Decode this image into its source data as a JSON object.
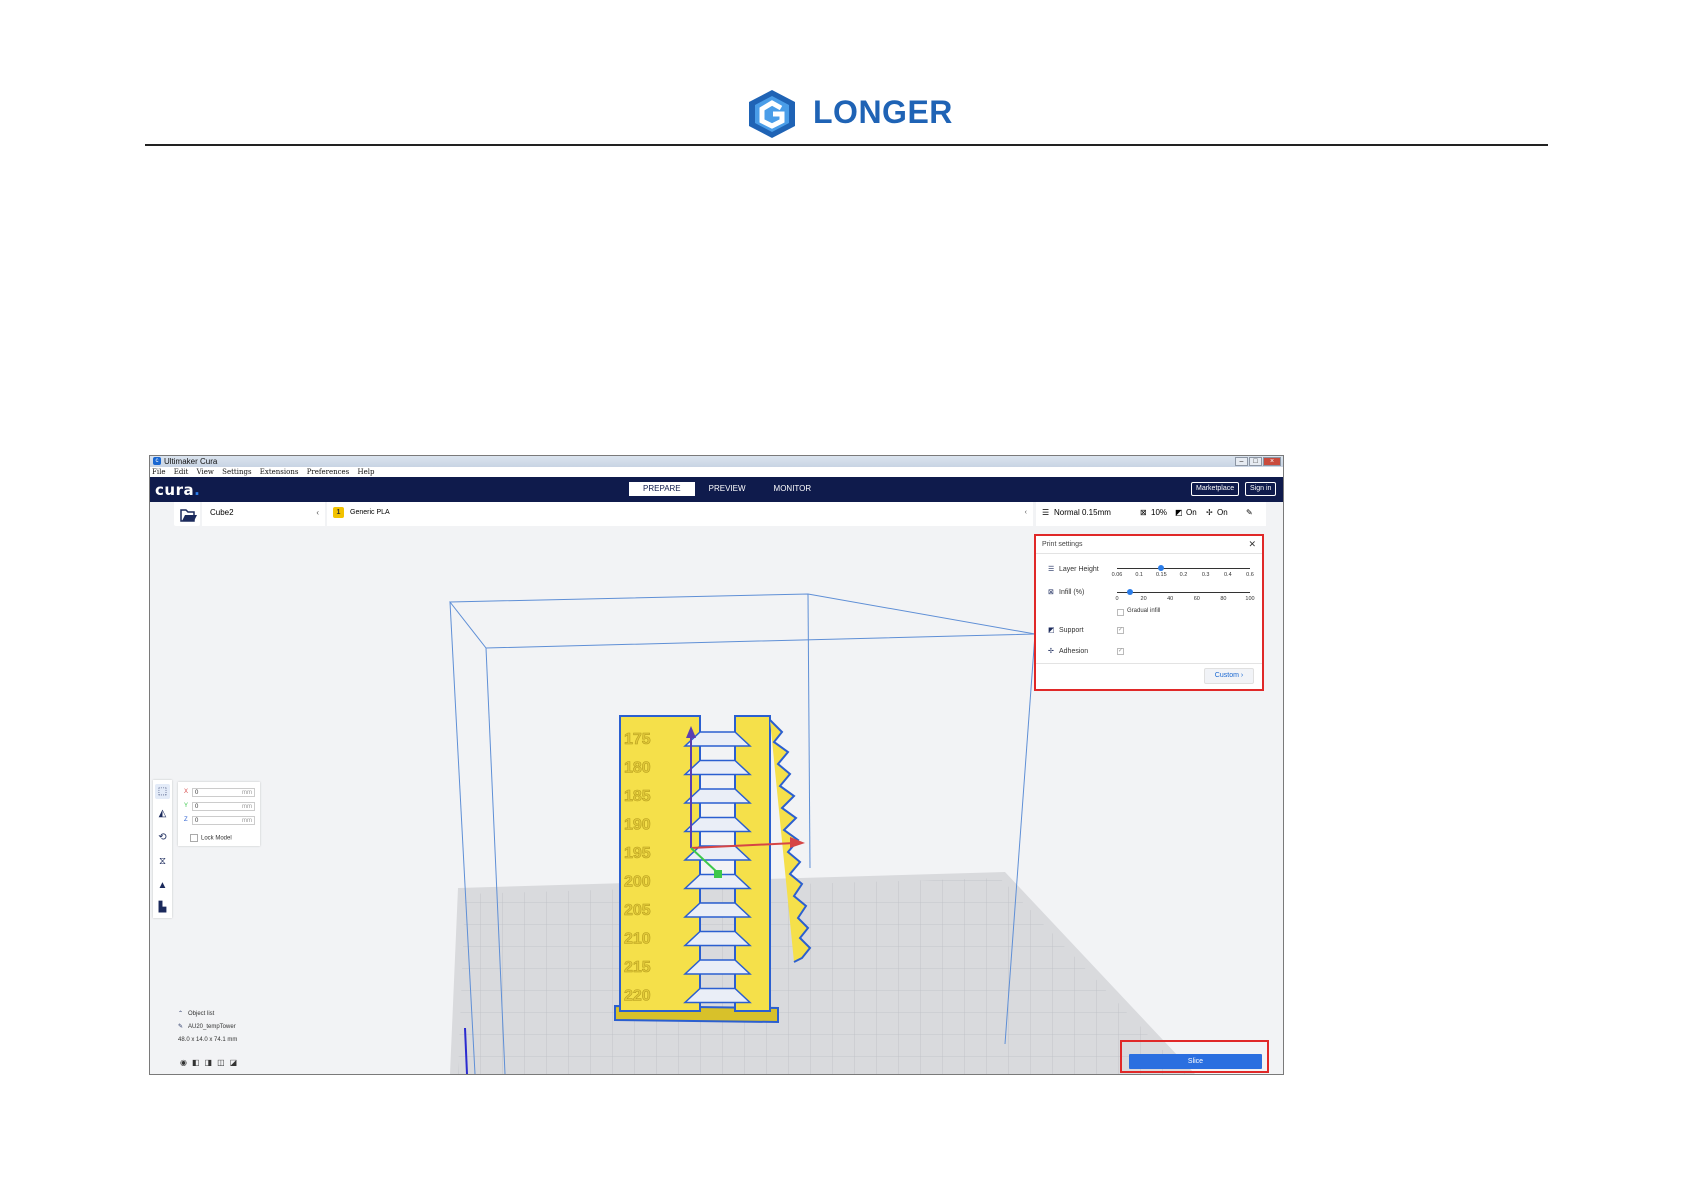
{
  "header": {
    "brand_text": "LONGER",
    "brand_color": "#1f63b5"
  },
  "window": {
    "title": "Ultimaker Cura",
    "menu": [
      "File",
      "Edit",
      "View",
      "Settings",
      "Extensions",
      "Preferences",
      "Help"
    ],
    "app_logo": "cura",
    "tabs": [
      "PREPARE",
      "PREVIEW",
      "MONITOR"
    ],
    "active_tab": "PREPARE",
    "marketplace_label": "Marketplace",
    "signin_label": "Sign in",
    "printer": "Cube2",
    "extruder_badge": "1",
    "material": "Generic PLA",
    "profile": "Normal 0.15mm",
    "infill_summary": "10%",
    "support_summary": "On",
    "adhesion_summary": "On"
  },
  "move_tool": {
    "x_label": "X",
    "x_value": "0",
    "y_label": "Y",
    "y_value": "0",
    "z_label": "Z",
    "z_value": "0",
    "unit": "mm",
    "lock_label": "Lock Model"
  },
  "print_settings": {
    "title": "Print settings",
    "layer_height_label": "Layer Height",
    "layer_height_ticks": [
      "0.06",
      "0.1",
      "0.15",
      "0.2",
      "0.3",
      "0.4",
      "0.6"
    ],
    "layer_height_value": "0.15",
    "infill_label": "Infill (%)",
    "infill_ticks": [
      "0",
      "20",
      "40",
      "60",
      "80",
      "100"
    ],
    "infill_value": 10,
    "gradual_infill_label": "Gradual infill",
    "support_label": "Support",
    "support_checked": true,
    "adhesion_label": "Adhesion",
    "adhesion_checked": true,
    "custom_label": "Custom"
  },
  "model": {
    "tower_labels": [
      "175",
      "180",
      "185",
      "190",
      "195",
      "200",
      "205",
      "210",
      "215",
      "220"
    ],
    "model_color": "#f5e04a"
  },
  "object_info": {
    "object_list_label": "Object list",
    "object_name": "AU20_tempTower",
    "dimensions": "48.0 x 14.0 x 74.1 mm"
  },
  "slice_label": "Slice",
  "colors": {
    "nav_bg": "#0f1b4c",
    "accent": "#2b6fe0",
    "highlight_box": "#e02828"
  }
}
